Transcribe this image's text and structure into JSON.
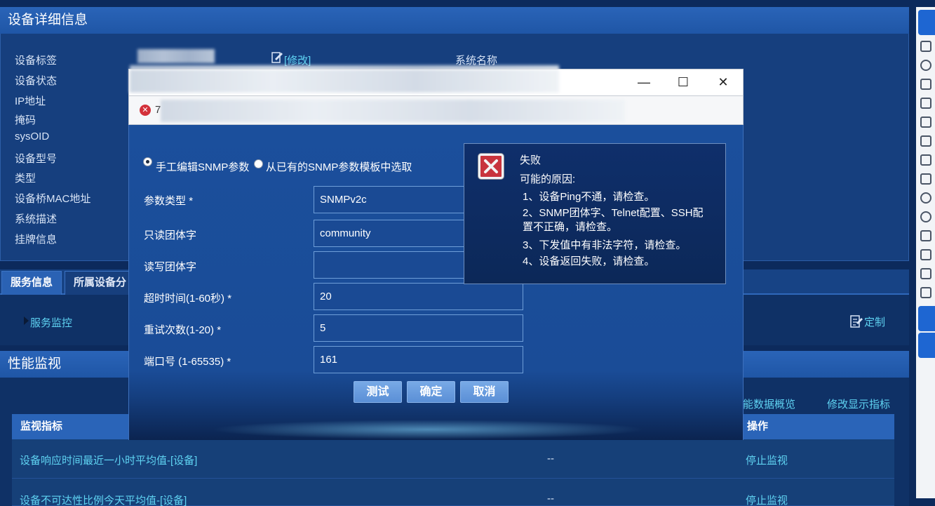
{
  "device_panel": {
    "title": "设备详细信息",
    "labels": [
      "设备标签",
      "设备状态",
      "IP地址",
      "掩码",
      "sysOID",
      "设备型号",
      "类型",
      "设备桥MAC地址",
      "系统描述",
      "挂牌信息"
    ],
    "edit_link": "[修改]",
    "system_name_label": "系统名称"
  },
  "tabs": [
    "服务信息",
    "所属设备分"
  ],
  "service": {
    "monitor_link": "服务监控",
    "customize_link": "定制"
  },
  "performance": {
    "title": "性能监视",
    "overview_link": "性能数据概览",
    "modify_link": "修改显示指标",
    "columns": [
      "监视指标",
      "操作"
    ],
    "rows": [
      {
        "metric": "设备响应时间最近一小时平均值-[设备]",
        "value": "--",
        "action": "停止监视"
      },
      {
        "metric": "设备不可达性比例今天平均值-[设备]",
        "value": "--",
        "action": "停止监视"
      }
    ]
  },
  "dialog": {
    "title_fragment": "7",
    "window_controls": {
      "minimize": "—",
      "maximize": "☐",
      "close": "✕"
    },
    "radio_manual": "手工编辑SNMP参数",
    "radio_template": "从已有的SNMP参数模板中选取",
    "fields": [
      {
        "label": "参数类型",
        "required": true,
        "value": "SNMPv2c"
      },
      {
        "label": "只读团体字",
        "required": false,
        "value": "community"
      },
      {
        "label": "读写团体字",
        "required": false,
        "value": ""
      },
      {
        "label": "超时时间(1-60秒)",
        "required": true,
        "value": "20"
      },
      {
        "label": "重试次数(1-20)",
        "required": true,
        "value": "5"
      },
      {
        "label": "端口号 (1-65535)",
        "required": true,
        "value": "161"
      }
    ],
    "buttons": {
      "test": "测试",
      "ok": "确定",
      "cancel": "取消"
    }
  },
  "error_popup": {
    "title": "失败",
    "reason_heading": "可能的原因:",
    "reasons": [
      "1、设备Ping不通，请检查。",
      "2、SNMP团体字、Telnet配置、SSH配置不正确，请检查。",
      "3、下发值中有非法字符，请检查。",
      "4、设备返回失败，请检查。"
    ]
  },
  "colors": {
    "background": "#0c2a5c",
    "panel_header": "#2a64b8",
    "link": "#5fd3f2",
    "error_red": "#c8343d",
    "dialog_body": "#1b4f9c"
  }
}
